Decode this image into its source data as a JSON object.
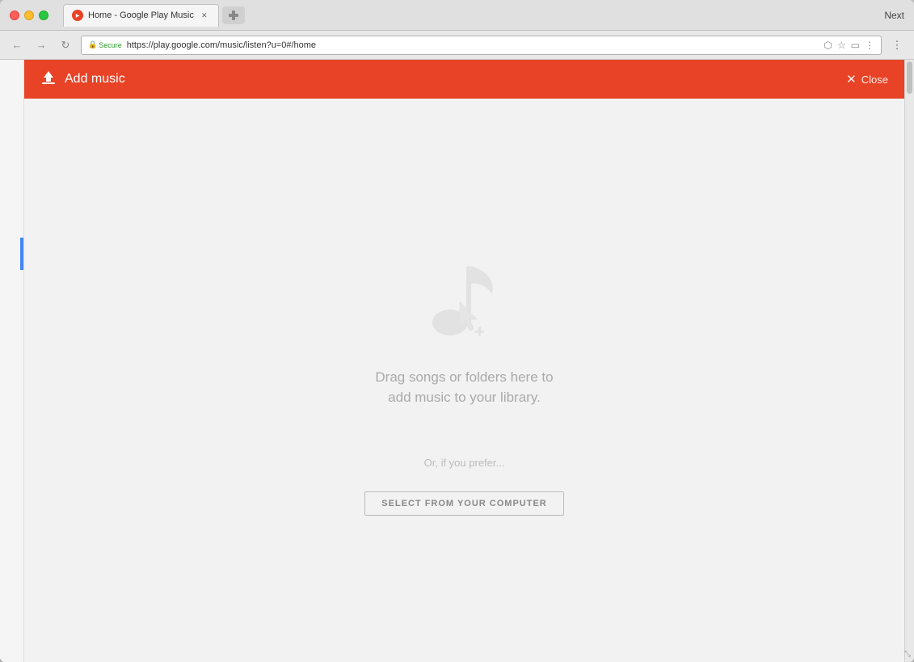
{
  "browser": {
    "title_bar": {
      "tab_title": "Home - Google Play Music",
      "next_label": "Next"
    },
    "address_bar": {
      "secure_label": "Secure",
      "url": "https://play.google.com/music/listen?u=0#/home"
    }
  },
  "modal": {
    "header": {
      "title": "Add music",
      "close_label": "Close"
    },
    "body": {
      "drag_text_line1": "Drag songs or folders here to",
      "drag_text_line2": "add music to your library.",
      "or_prefer_label": "Or, if you prefer...",
      "select_button_label": "SELECT FROM YOUR COMPUTER"
    }
  }
}
